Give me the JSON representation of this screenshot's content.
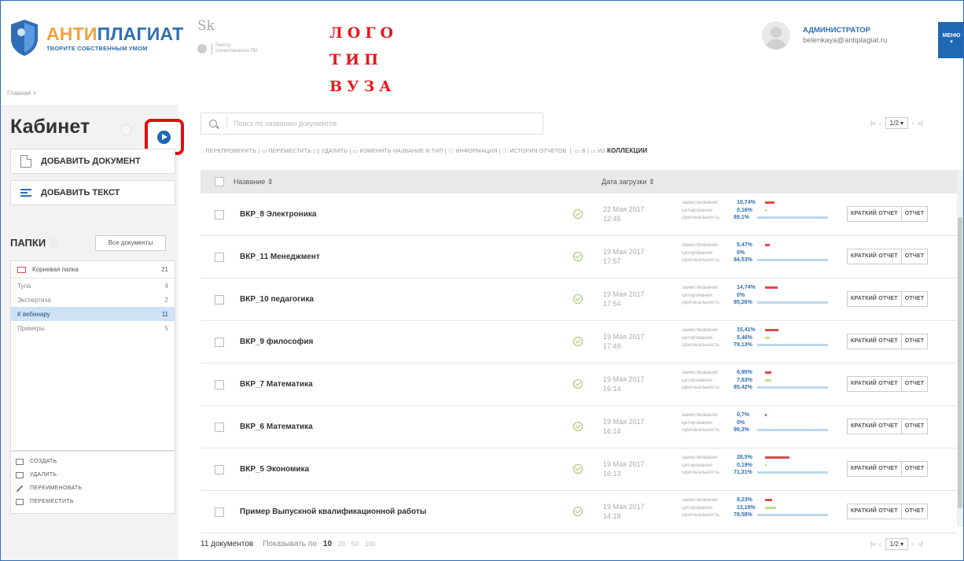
{
  "header": {
    "brand_name_part1": "АНТИ",
    "brand_name_part2": "ПЛАГИАТ",
    "brand_tagline": "ТВОРИТЕ СОБСТВЕННЫМ УМОМ",
    "sk_logo": "Sk",
    "registry_text_1": "Реестр",
    "registry_text_2": "отечественного ПО",
    "vuz_logo_line1": "ЛОГО",
    "vuz_logo_line2": "ТИП",
    "vuz_logo_line3": "ВУЗА",
    "user_role": "АДМИНИСТРАТОР",
    "user_email": "belenkaya@antiplagiat.ru",
    "menu_label": "МЕНЮ"
  },
  "breadcrumb": "Главная >",
  "sidebar": {
    "title": "Кабинет",
    "add_document": "ДОБАВИТЬ ДОКУМЕНТ",
    "add_text": "ДОБАВИТЬ ТЕКСТ",
    "folders_title": "ПАПКИ",
    "all_documents": "Все документы",
    "root_folder": {
      "label": "Корневая папка",
      "count": "21"
    },
    "folders": [
      {
        "label": "Тула",
        "count": "4",
        "active": false
      },
      {
        "label": "Экспертиза",
        "count": "2",
        "active": false
      },
      {
        "label": "К вебинару",
        "count": "11",
        "active": true
      },
      {
        "label": "Примеры",
        "count": "5",
        "active": false
      }
    ],
    "actions": [
      "СОЗДАТЬ",
      "УДАЛИТЬ",
      "ПЕРЕИМЕНОВАТЬ",
      "ПЕРЕМЕСТИТЬ"
    ]
  },
  "search": {
    "placeholder": "Поиск по названию документов"
  },
  "pager": {
    "first": "|«",
    "prev": "‹",
    "page": "1/2",
    "dropdown": "▾",
    "next": "›",
    "last": "»|"
  },
  "toolbar": {
    "actions": [
      "ПЕРЕПРОВЕРИТЬ",
      "ПЕРЕМЕСТИТЬ",
      "УДАЛИТЬ",
      "ИЗМЕНИТЬ НАЗВАНИЕ И ТИП",
      "ИНФОРМАЦИЯ",
      "ИСТОРИЯ ОТЧЕТОВ",
      "В",
      "ИЗ"
    ],
    "collections": "КОЛЛЕКЦИИ"
  },
  "table": {
    "col_name": "Название",
    "col_date": "Дата загрузки",
    "stat_labels": {
      "borrow": "заимствования",
      "cite": "цитирования",
      "orig": "оригинальность"
    },
    "btn_short": "КРАТКИЙ ОТЧЕТ",
    "btn_report": "ОТЧЕТ",
    "rows": [
      {
        "name": "ВКР_8 Электроника",
        "date": "22 Мая 2017",
        "time": "12:45",
        "borrow": "10,74%",
        "cite": "0,16%",
        "orig": "89,1%",
        "borrow_frac": 0.1074,
        "cite_frac": 0.0016
      },
      {
        "name": "ВКР_11 Менеджмент",
        "date": "19 Мая 2017",
        "time": "17:57",
        "borrow": "5,47%",
        "cite": "0%",
        "orig": "94,53%",
        "borrow_frac": 0.0547,
        "cite_frac": 0
      },
      {
        "name": "ВКР_10 педагогика",
        "date": "19 Мая 2017",
        "time": "17:54",
        "borrow": "14,74%",
        "cite": "0%",
        "orig": "85,26%",
        "borrow_frac": 0.1474,
        "cite_frac": 0
      },
      {
        "name": "ВКР_9 философия",
        "date": "19 Мая 2017",
        "time": "17:49",
        "borrow": "15,41%",
        "cite": "5,46%",
        "orig": "79,13%",
        "borrow_frac": 0.1541,
        "cite_frac": 0.0546
      },
      {
        "name": "ВКР_7 Математика",
        "date": "19 Мая 2017",
        "time": "16:14",
        "borrow": "6,95%",
        "cite": "7,63%",
        "orig": "85,42%",
        "borrow_frac": 0.0695,
        "cite_frac": 0.0763
      },
      {
        "name": "ВКР_6 Математика",
        "date": "19 Мая 2017",
        "time": "16:14",
        "borrow": "0,7%",
        "cite": "0%",
        "orig": "99,3%",
        "borrow_frac": 0.007,
        "cite_frac": 0
      },
      {
        "name": "ВКР_5 Экономика",
        "date": "19 Мая 2017",
        "time": "16:13",
        "borrow": "28,5%",
        "cite": "0,19%",
        "orig": "71,31%",
        "borrow_frac": 0.285,
        "cite_frac": 0.0019
      },
      {
        "name": "Пример Выпускной квалификационной работы",
        "date": "19 Мая 2017",
        "time": "14:18",
        "borrow": "8,23%",
        "cite": "13,19%",
        "orig": "78,58%",
        "borrow_frac": 0.0823,
        "cite_frac": 0.1319
      }
    ]
  },
  "footer": {
    "count": "11 документов",
    "show_by": "Показывать по",
    "options": [
      "10",
      "20",
      "50",
      "100"
    ],
    "selected": "10"
  },
  "colors": {
    "brand_blue": "#2f6eb5",
    "brand_orange": "#f4a23b",
    "highlight_red": "#e20f0f",
    "bar_red": "#e04a4a",
    "bar_green": "#bde28a"
  }
}
